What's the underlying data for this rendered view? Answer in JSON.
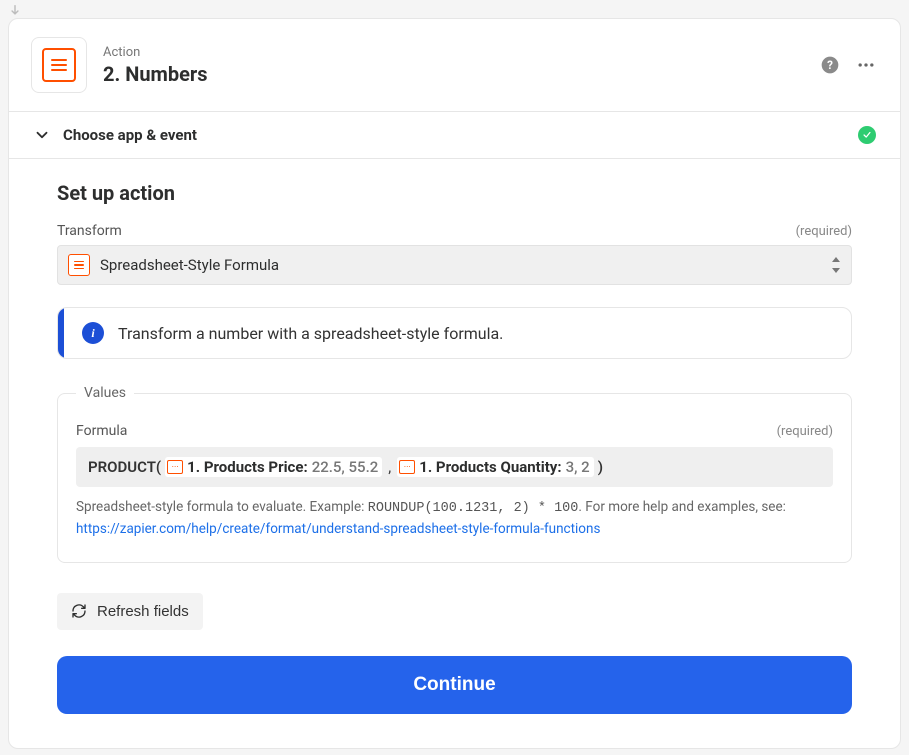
{
  "header": {
    "kicker": "Action",
    "title": "2. Numbers"
  },
  "collapse": {
    "label": "Choose app & event",
    "completed": true
  },
  "section": {
    "title": "Set up action"
  },
  "transform": {
    "label": "Transform",
    "required_text": "(required)",
    "selected": "Spreadsheet-Style Formula"
  },
  "info": {
    "text": "Transform a number with a spreadsheet-style formula."
  },
  "values": {
    "legend": "Values",
    "formula_label": "Formula",
    "required_text": "(required)",
    "fn_open": "PRODUCT(",
    "pill1_label": "1. Products Price:",
    "pill1_value": "22.5, 55.2",
    "comma": ",",
    "pill2_label": "1. Products Quantity:",
    "pill2_value": "3, 2",
    "fn_close": ")",
    "help_pre": "Spreadsheet-style formula to evaluate. Example: ",
    "help_code": "ROUNDUP(100.1231, 2) * 100",
    "help_post": ". For more help and examples, see:",
    "help_link": "https://zapier.com/help/create/format/understand-spreadsheet-style-formula-functions"
  },
  "buttons": {
    "refresh": "Refresh fields",
    "continue": "Continue"
  }
}
